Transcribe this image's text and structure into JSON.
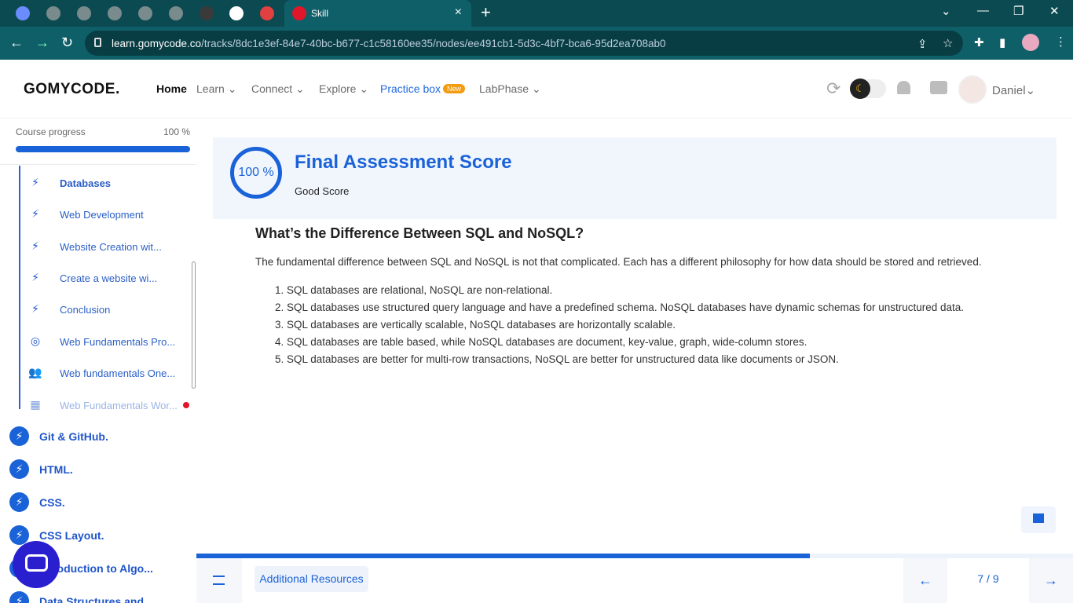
{
  "browser": {
    "tab_title": "Skill",
    "url_host": "learn.gomycode.co",
    "url_path": "/tracks/8dc1e3ef-84e7-40bc-b677-c1c58160ee35/nodes/ee491cb1-5d3c-4bf7-bca6-95d2ea708ab0",
    "new_tab_label": "+"
  },
  "header": {
    "logo": "GOMYCODE.",
    "nav": {
      "home": "Home",
      "learn": "Learn",
      "connect": "Connect",
      "explore": "Explore",
      "practice_box": "Practice box",
      "new_badge": "New",
      "labphase": "LabPhase"
    },
    "user_name": "Daniel"
  },
  "sidebar": {
    "progress_label": "Course progress",
    "progress_value": "100 %",
    "progress_fraction": 1.0,
    "sub_items": [
      {
        "label": "Databases",
        "icon": "bolt-icon",
        "active": true
      },
      {
        "label": "Web Development",
        "icon": "bolt-icon"
      },
      {
        "label": "Website Creation wit...",
        "icon": "bolt-icon"
      },
      {
        "label": "Create a website wi...",
        "icon": "bolt-icon"
      },
      {
        "label": "Conclusion",
        "icon": "bolt-icon"
      },
      {
        "label": "Web Fundamentals Pro...",
        "icon": "target-icon"
      },
      {
        "label": "Web fundamentals One...",
        "icon": "people-icon"
      },
      {
        "label": "Web Fundamentals Wor...",
        "icon": "workshop-icon",
        "faded": true
      }
    ],
    "modules": [
      {
        "label": "Git & GitHub."
      },
      {
        "label": "HTML."
      },
      {
        "label": "CSS."
      },
      {
        "label": "CSS Layout."
      },
      {
        "label": "Introduction to Algo..."
      },
      {
        "label": "Data Structures and..."
      }
    ]
  },
  "assessment": {
    "score": "100 %",
    "title": "Final Assessment Score",
    "subtitle": "Good Score"
  },
  "article": {
    "title": "What’s the Difference Between SQL and NoSQL?",
    "intro": "The fundamental difference between SQL and NoSQL is not that complicated. Each has a different philosophy for how data should be stored and retrieved.",
    "points": [
      "SQL databases are relational, NoSQL are non-relational.",
      "SQL databases use structured query language and have a predefined schema. NoSQL databases have dynamic schemas for unstructured data.",
      "SQL databases are vertically scalable, NoSQL databases are horizontally scalable.",
      "SQL databases are table based, while NoSQL databases are document, key-value, graph, wide-column stores.",
      "SQL databases are better for multi-row transactions, NoSQL are better for unstructured data like documents or JSON."
    ]
  },
  "footer": {
    "resources_label": "Additional Resources",
    "page_indicator": "7 / 9",
    "lesson_progress_fraction": 0.7
  },
  "colors": {
    "accent": "#1a62d8",
    "browser_bar": "#0f5f69",
    "tab_strip": "#0c4a52",
    "badge": "#f39c12",
    "alert_dot": "#e0162b"
  }
}
